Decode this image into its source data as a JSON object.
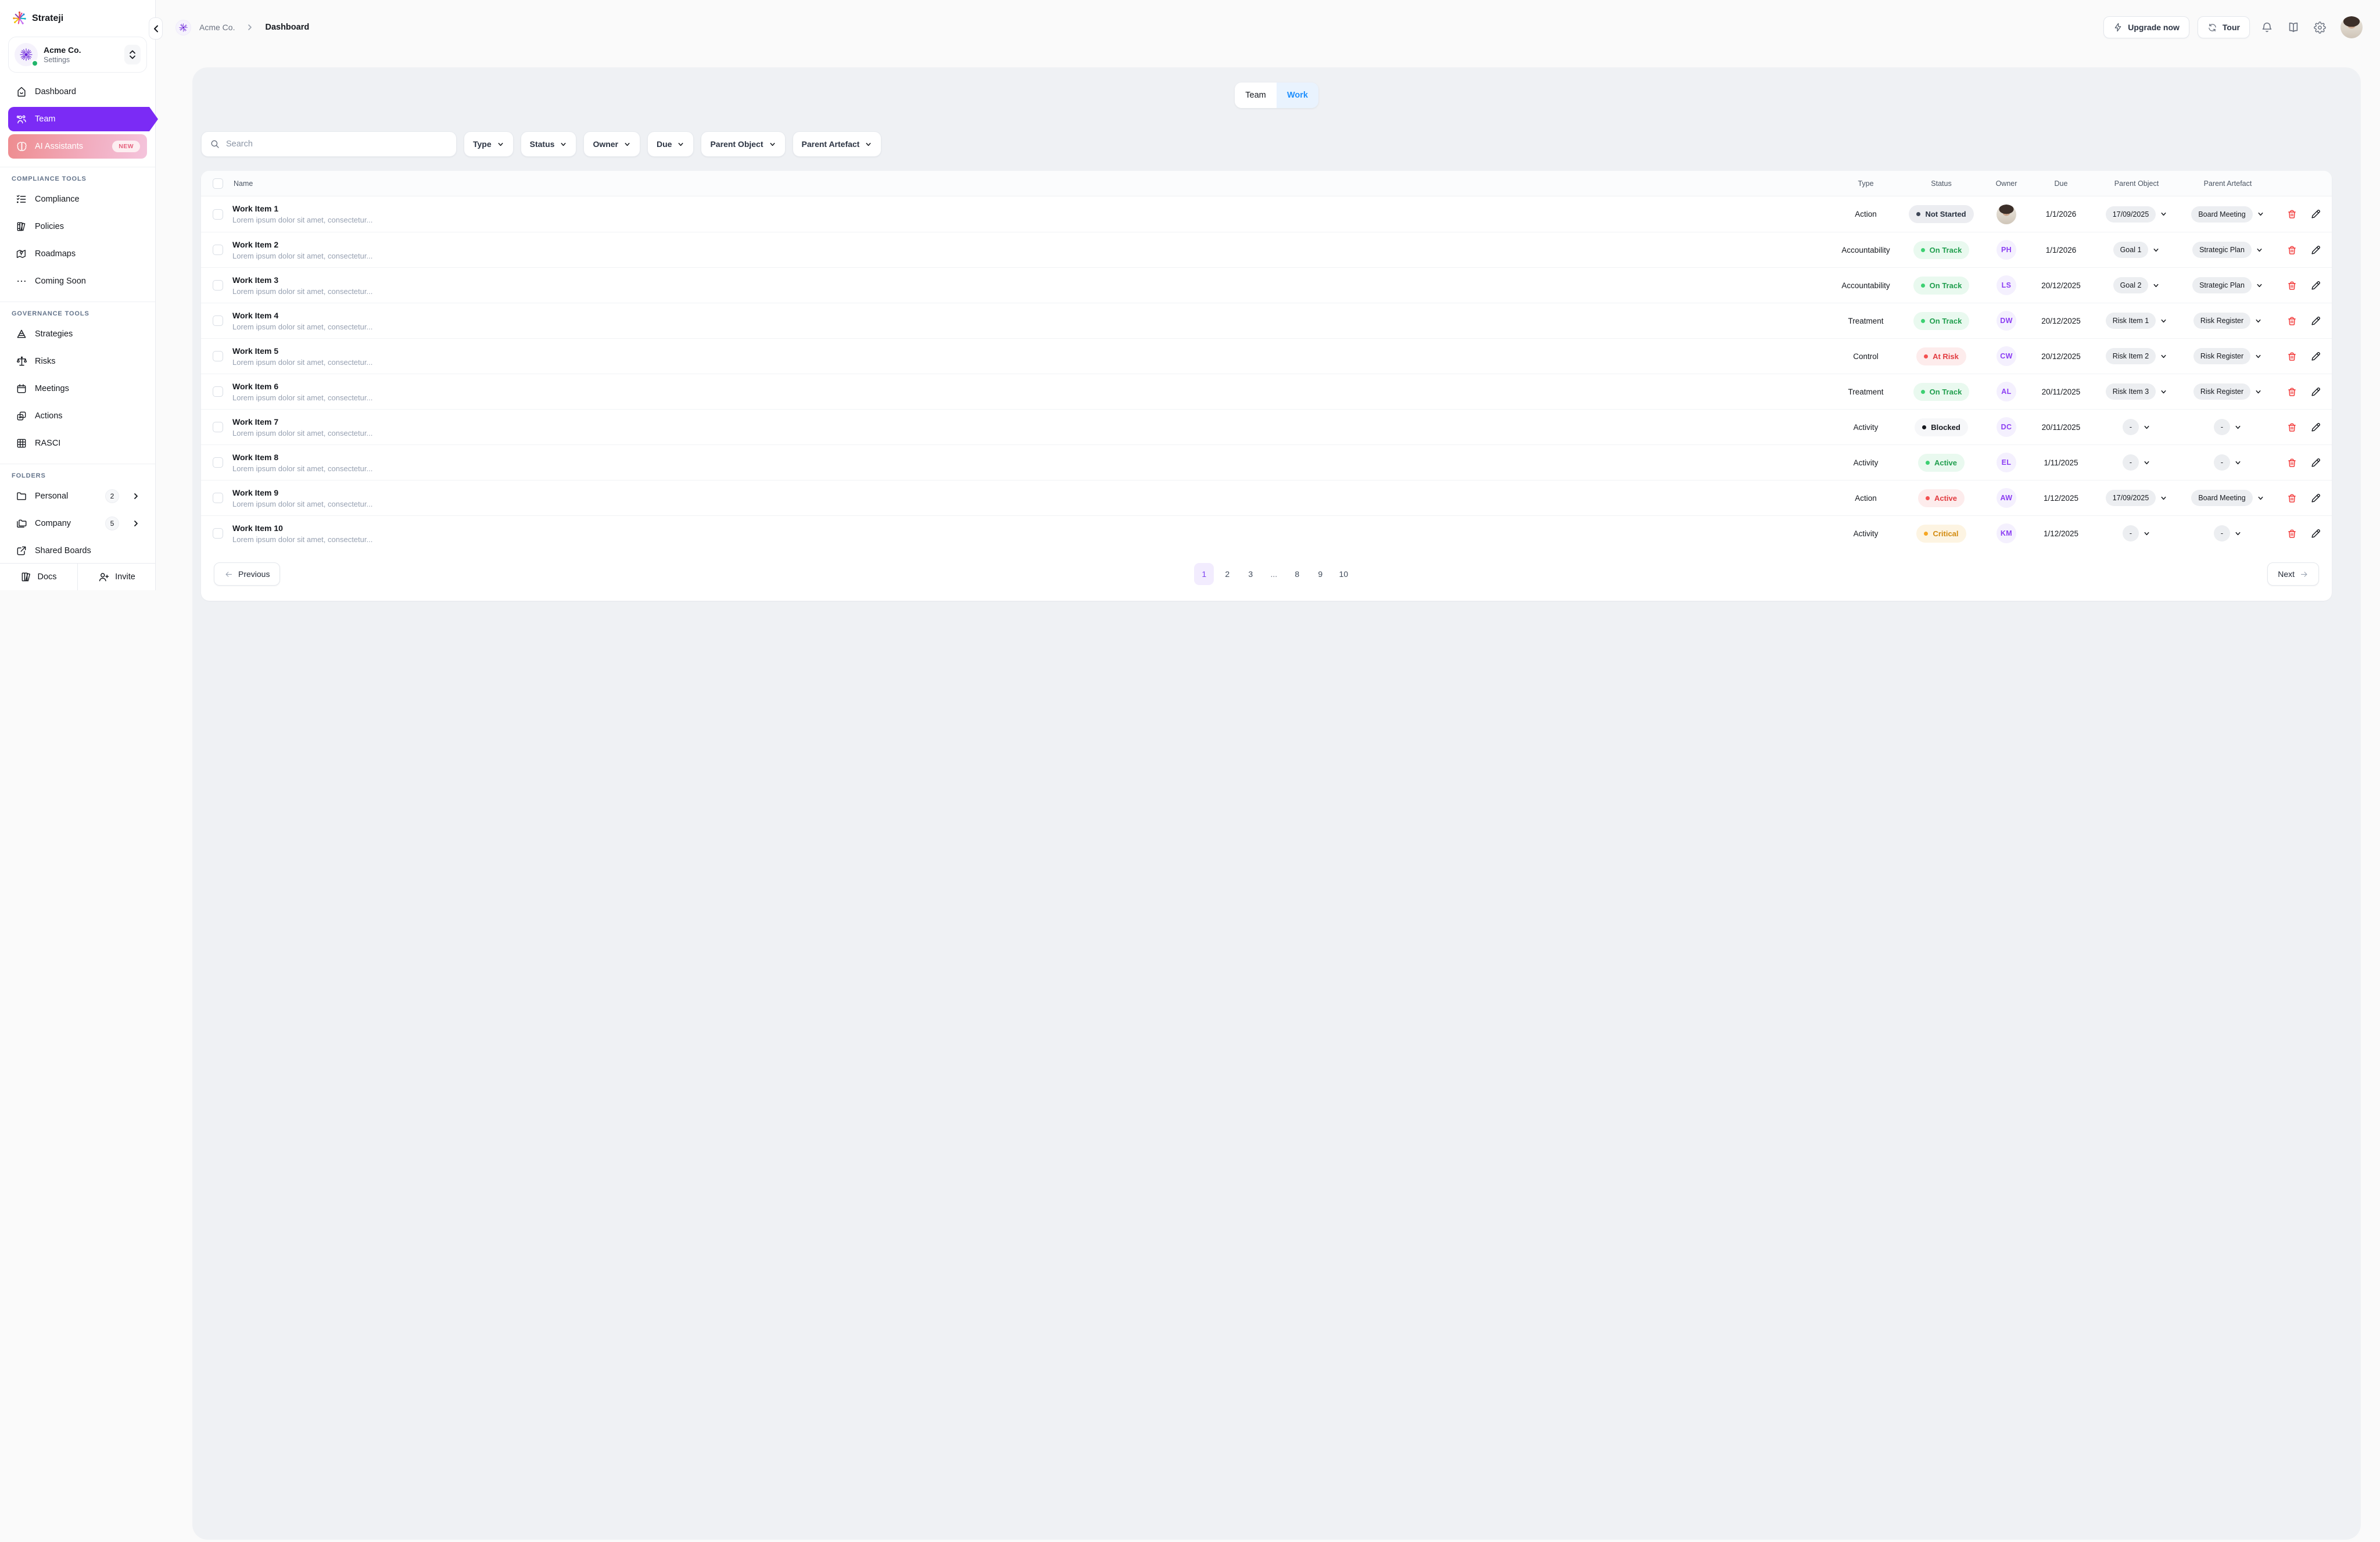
{
  "app": {
    "name": "Strateji"
  },
  "sidebar": {
    "workspace": {
      "name": "Acme Co.",
      "subtitle": "Settings"
    },
    "nav": [
      {
        "label": "Dashboard",
        "icon": "home-icon",
        "state": "default"
      },
      {
        "label": "Team",
        "icon": "users-icon",
        "state": "active"
      },
      {
        "label": "AI Assistants",
        "icon": "brain-icon",
        "state": "ai",
        "badge": "NEW"
      }
    ],
    "sections": [
      {
        "label": "COMPLIANCE TOOLS",
        "items": [
          {
            "label": "Compliance",
            "icon": "checklist-icon"
          },
          {
            "label": "Policies",
            "icon": "books-icon"
          },
          {
            "label": "Roadmaps",
            "icon": "map-icon"
          },
          {
            "label": "Coming Soon",
            "icon": "ellipsis-icon"
          }
        ]
      },
      {
        "label": "GOVERNANCE TOOLS",
        "items": [
          {
            "label": "Strategies",
            "icon": "pyramid-icon"
          },
          {
            "label": "Risks",
            "icon": "scales-icon"
          },
          {
            "label": "Meetings",
            "icon": "calendar-icon"
          },
          {
            "label": "Actions",
            "icon": "squares-check-icon"
          },
          {
            "label": "RASCI",
            "icon": "grid-icon"
          }
        ]
      },
      {
        "label": "FOLDERS",
        "items": [
          {
            "label": "Personal",
            "icon": "folder-icon",
            "count": "2",
            "chevron": true
          },
          {
            "label": "Company",
            "icon": "folders-icon",
            "count": "5",
            "chevron": true
          },
          {
            "label": "Shared Boards",
            "icon": "share-icon"
          }
        ]
      }
    ],
    "footer": {
      "docs": "Docs",
      "invite": "Invite"
    }
  },
  "topbar": {
    "breadcrumb": {
      "workspace": "Acme Co.",
      "page": "Dashboard"
    },
    "upgrade_label": "Upgrade now",
    "tour_label": "Tour"
  },
  "tabs": [
    {
      "label": "Team",
      "active": false
    },
    {
      "label": "Work",
      "active": true
    }
  ],
  "search": {
    "placeholder": "Search"
  },
  "filters": [
    "Type",
    "Status",
    "Owner",
    "Due",
    "Parent Object",
    "Parent Artefact"
  ],
  "table": {
    "columns": [
      "Name",
      "Type",
      "Status",
      "Owner",
      "Due",
      "Parent Object",
      "Parent Artefact"
    ],
    "status_variants": {
      "neutral": {
        "bg": "#ecedf1",
        "dot": "#3e4757",
        "text": "#27303f"
      },
      "green": {
        "bg": "#e9f9ef",
        "dot": "#3dd072",
        "text": "#1f9e4d"
      },
      "red": {
        "bg": "#fdecec",
        "dot": "#f35050",
        "text": "#e23c41"
      },
      "dark": {
        "bg": "#f6f7f9",
        "dot": "#15181e",
        "text": "#15181e"
      },
      "orange": {
        "bg": "#fdf4e2",
        "dot": "#f6a723",
        "text": "#d28a0e"
      }
    },
    "rows": [
      {
        "name": "Work Item 1",
        "desc": "Lorem ipsum dolor sit amet, consectetur...",
        "type": "Action",
        "status": "Not Started",
        "variant": "neutral",
        "owner": "photo",
        "due": "1/1/2026",
        "parent_object": "17/09/2025",
        "parent_artefact": "Board Meeting"
      },
      {
        "name": "Work Item 2",
        "desc": "Lorem ipsum dolor sit amet, consectetur...",
        "type": "Accountability",
        "status": "On Track",
        "variant": "green",
        "owner": "PH",
        "due": "1/1/2026",
        "parent_object": "Goal 1",
        "parent_artefact": "Strategic Plan"
      },
      {
        "name": "Work Item 3",
        "desc": "Lorem ipsum dolor sit amet, consectetur...",
        "type": "Accountability",
        "status": "On Track",
        "variant": "green",
        "owner": "LS",
        "due": "20/12/2025",
        "parent_object": "Goal 2",
        "parent_artefact": "Strategic Plan"
      },
      {
        "name": "Work Item 4",
        "desc": "Lorem ipsum dolor sit amet, consectetur...",
        "type": "Treatment",
        "status": "On Track",
        "variant": "green",
        "owner": "DW",
        "due": "20/12/2025",
        "parent_object": "Risk Item 1",
        "parent_artefact": "Risk Register"
      },
      {
        "name": "Work Item 5",
        "desc": "Lorem ipsum dolor sit amet, consectetur...",
        "type": "Control",
        "status": "At Risk",
        "variant": "red",
        "owner": "CW",
        "due": "20/12/2025",
        "parent_object": "Risk Item 2",
        "parent_artefact": "Risk Register"
      },
      {
        "name": "Work Item 6",
        "desc": "Lorem ipsum dolor sit amet, consectetur...",
        "type": "Treatment",
        "status": "On Track",
        "variant": "green",
        "owner": "AL",
        "due": "20/11/2025",
        "parent_object": "Risk Item 3",
        "parent_artefact": "Risk Register"
      },
      {
        "name": "Work Item 7",
        "desc": "Lorem ipsum dolor sit amet, consectetur...",
        "type": "Activity",
        "status": "Blocked",
        "variant": "dark",
        "owner": "DC",
        "due": "20/11/2025",
        "parent_object": "-",
        "parent_artefact": "-"
      },
      {
        "name": "Work Item 8",
        "desc": "Lorem ipsum dolor sit amet, consectetur...",
        "type": "Activity",
        "status": "Active",
        "variant": "green",
        "owner": "EL",
        "due": "1/11/2025",
        "parent_object": "-",
        "parent_artefact": "-"
      },
      {
        "name": "Work Item 9",
        "desc": "Lorem ipsum dolor sit amet, consectetur...",
        "type": "Action",
        "status": "Active",
        "variant": "red",
        "owner": "AW",
        "due": "1/12/2025",
        "parent_object": "17/09/2025",
        "parent_artefact": "Board Meeting"
      },
      {
        "name": "Work Item 10",
        "desc": "Lorem ipsum dolor sit amet, consectetur...",
        "type": "Activity",
        "status": "Critical",
        "variant": "orange",
        "owner": "KM",
        "due": "1/12/2025",
        "parent_object": "-",
        "parent_artefact": "-"
      }
    ]
  },
  "pagination": {
    "previous_label": "Previous",
    "next_label": "Next",
    "pages": [
      "1",
      "2",
      "3",
      "...",
      "8",
      "9",
      "10"
    ],
    "active_page": "1"
  },
  "colors": {
    "accent_purple": "#7b2bf5",
    "tab_blue": "#1e8ffd",
    "danger_red": "#f23d3d"
  }
}
